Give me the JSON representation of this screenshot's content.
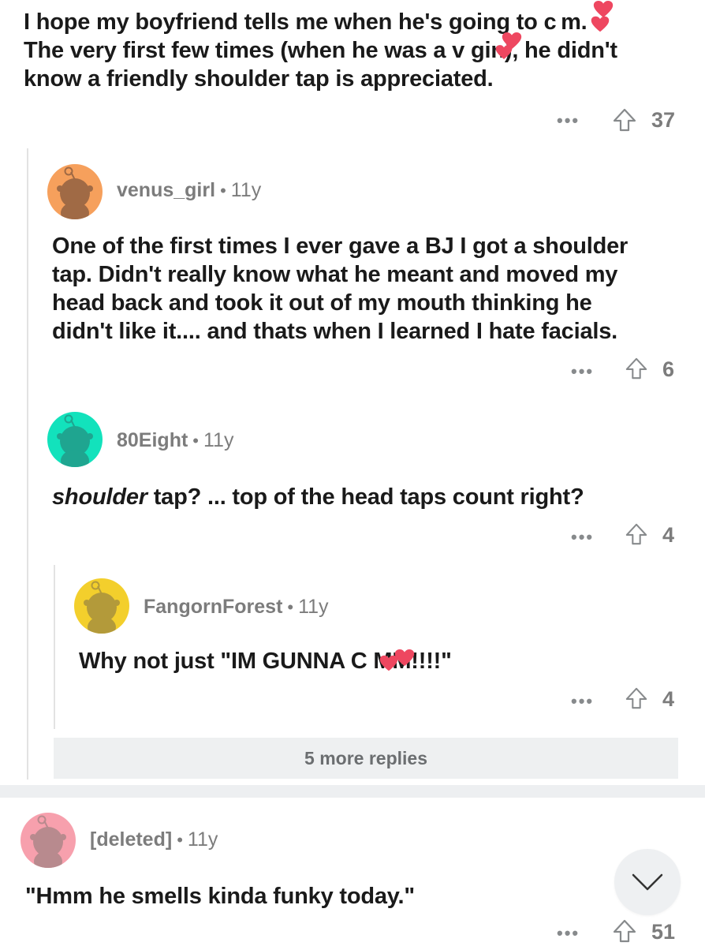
{
  "post": {
    "lines": [
      "I hope my boyfriend tells me when he's going to c m.",
      "The very first few times (when he was a v  gin), he didn't",
      "know a friendly shoulder tap is appreciated."
    ],
    "votes": "37",
    "more_label": "•••"
  },
  "comments": [
    {
      "username": "venus_girl",
      "dot": "•",
      "age": "11y",
      "avatar_color": "#f6a05c",
      "lines": [
        "One of the first times I ever gave a BJ I got a shoulder",
        "tap. Didn't really know what he meant and moved my",
        "head back and took it out of my mouth thinking he",
        "didn't like it.... and thats when I learned I hate facials."
      ],
      "votes": "6",
      "more_label": "•••"
    },
    {
      "username": "80Eight",
      "dot": "•",
      "age": "11y",
      "avatar_color": "#12e2bc",
      "text_italic": "shoulder",
      "text_rest": " tap? ... top of the head taps count right?",
      "votes": "4",
      "more_label": "•••"
    },
    {
      "username": "FangornForest",
      "dot": "•",
      "age": "11y",
      "avatar_color": "#f3cf2c",
      "text": "Why not just \"IM GUNNA C   MM!!!!\"",
      "votes": "4",
      "more_label": "•••"
    },
    {
      "username": "[deleted]",
      "dot": "•",
      "age": "11y",
      "avatar_color": "#f7a0ad",
      "text": "\"Hmm he smells kinda funky today.\"",
      "votes": "51",
      "more_label": "•••"
    }
  ],
  "more_replies": "5 more replies",
  "icons": {
    "upvote": "upvote-arrow-icon",
    "scroll": "chevron-down-icon",
    "sticker": "heart-sticker-icon",
    "avatar": "snoo-avatar-icon"
  },
  "colors": {
    "meta_gray": "#7c7c7c",
    "heart_red": "#ee4760",
    "thread_line": "#e3e3e3"
  }
}
